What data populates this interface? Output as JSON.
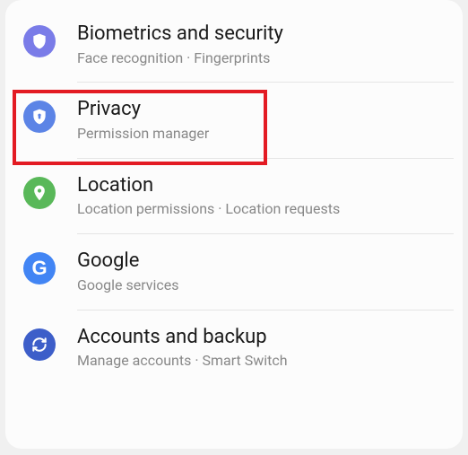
{
  "items": [
    {
      "title": "Biometrics and security",
      "sub": "Face recognition  ·  Fingerprints"
    },
    {
      "title": "Privacy",
      "sub": "Permission manager"
    },
    {
      "title": "Location",
      "sub": "Location permissions  ·  Location requests"
    },
    {
      "title": "Google",
      "sub": "Google services"
    },
    {
      "title": "Accounts and backup",
      "sub": "Manage accounts  ·  Smart Switch"
    }
  ]
}
